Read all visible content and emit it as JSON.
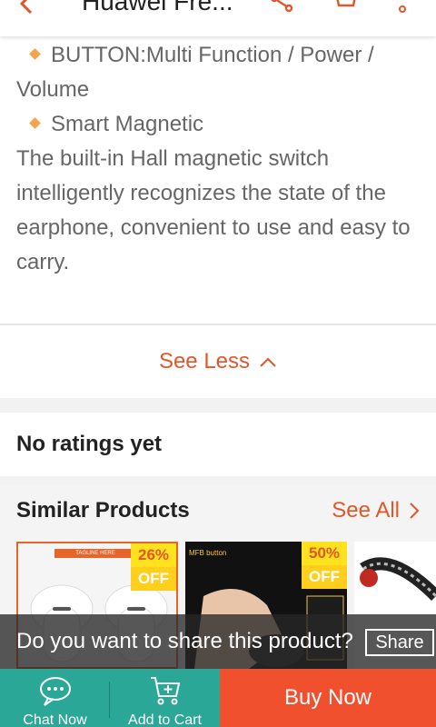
{
  "header": {
    "title": "Huawei Fre...",
    "icons": [
      "back-icon",
      "share-icon",
      "cart-icon",
      "more-icon"
    ]
  },
  "description": {
    "bullet1": "BUTTON:Multi Function / Power / Volume",
    "bullet2": "Smart Magnetic",
    "paragraph": "The built-in Hall magnetic switch intelligently recognizes the state of the earphone, convenient to use and easy to carry."
  },
  "see_less": "See Less",
  "ratings": "No ratings yet",
  "similar": {
    "title": "Similar Products",
    "see_all": "See All",
    "products": [
      {
        "discount": "26%",
        "off": "OFF",
        "tagline": "TAGLINE HERE"
      },
      {
        "discount": "50%",
        "off": "OFF",
        "tagline": "MFB button"
      },
      {
        "discount": "",
        "off": ""
      }
    ]
  },
  "share_prompt": {
    "text": "Do you want to share this product?",
    "button": "Share"
  },
  "bottom": {
    "chat": "Chat Now",
    "add_to_cart": "Add to Cart",
    "buy_now": "Buy Now"
  },
  "colors": {
    "accent": "#e0572a",
    "teal": "#2aa797",
    "buy": "#f0502e"
  }
}
